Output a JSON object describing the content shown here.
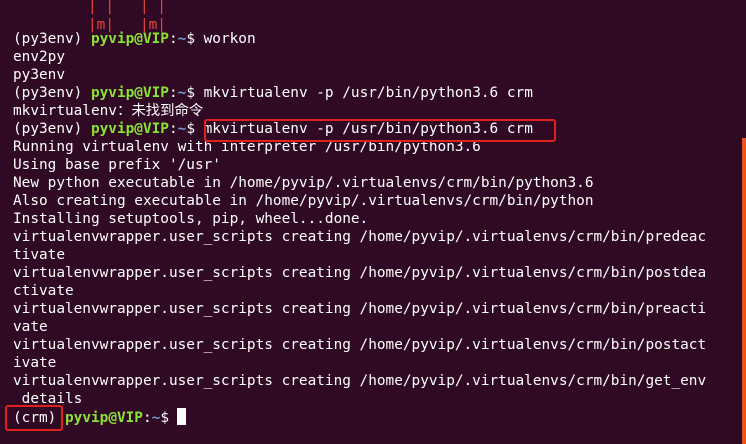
{
  "terminal": {
    "ascii_art": "| |   | |\n|m|   |m|",
    "prompt_env": "(py3env) ",
    "prompt_user": "pyvip@VIP",
    "prompt_colon": ":",
    "prompt_path": "~",
    "prompt_dollar": "$ ",
    "cmd1": "workon",
    "env_list": [
      "env2py",
      "py3env"
    ],
    "cmd2": "mkvirtualenv -p /usr/bin/python3.6 crm",
    "err_line": "mkvirtualenv：未找到命令",
    "cmd3": "mkvirtualenv -p /usr/bin/python3.6 crm",
    "output": [
      "Running virtualenv with interpreter /usr/bin/python3.6",
      "Using base prefix '/usr'",
      "New python executable in /home/pyvip/.virtualenvs/crm/bin/python3.6",
      "Also creating executable in /home/pyvip/.virtualenvs/crm/bin/python",
      "Installing setuptools, pip, wheel...done.",
      "virtualenvwrapper.user_scripts creating /home/pyvip/.virtualenvs/crm/bin/predeac",
      "tivate",
      "virtualenvwrapper.user_scripts creating /home/pyvip/.virtualenvs/crm/bin/postdea",
      "ctivate",
      "virtualenvwrapper.user_scripts creating /home/pyvip/.virtualenvs/crm/bin/preacti",
      "vate",
      "virtualenvwrapper.user_scripts creating /home/pyvip/.virtualenvs/crm/bin/postact",
      "ivate",
      "virtualenvwrapper.user_scripts creating /home/pyvip/.virtualenvs/crm/bin/get_env",
      "_details"
    ],
    "final_env": "(crm)",
    "final_user": "pyvip@VIP",
    "final_colon": ":",
    "final_path": "~",
    "final_dollar": "$"
  },
  "colors": {
    "background": "#300a24",
    "user": "#8ae234",
    "path": "#729fcf",
    "highlight": "#e0201b",
    "scrollbar": "#e95420"
  }
}
